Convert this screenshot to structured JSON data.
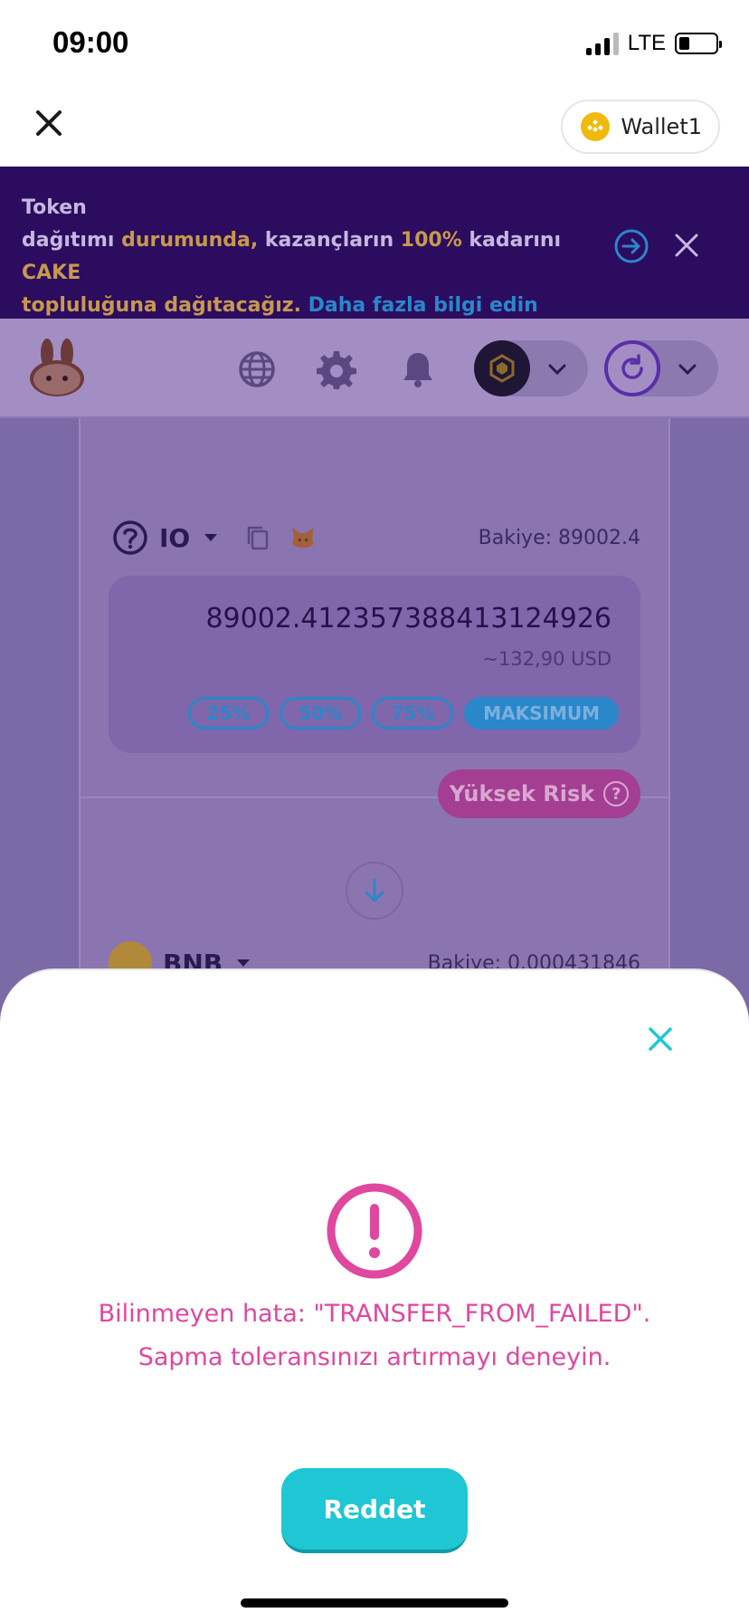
{
  "status_bar": {
    "time": "09:00",
    "network": "LTE"
  },
  "header": {
    "wallet_label": "Wallet1"
  },
  "banner": {
    "line1": "Token",
    "part_a": "dağıtımı ",
    "part_b": "durumunda,",
    "part_c": " kazançların ",
    "part_d": "100%",
    "part_e": " kadarını ",
    "part_f": "CAKE",
    "part_g": "topluluğuna dağıtacağız.",
    "link": "Daha fazla bilgi edin"
  },
  "swap": {
    "from_token": "IO",
    "from_balance": "Bakiye: 89002.4",
    "amount": "89002.412357388413124926",
    "amount_usd": "~132,90 USD",
    "percent_buttons": [
      "25%",
      "50%",
      "75%",
      "MAKSIMUM"
    ],
    "risk_label": "Yüksek Risk",
    "to_token": "BNB",
    "to_balance": "Bakiye: 0.000431846"
  },
  "modal": {
    "error_message": "Bilinmeyen hata: \"TRANSFER_FROM_FAILED\". Sapma toleransınızı artırmayı deneyin.",
    "dismiss_label": "Reddet"
  },
  "colors": {
    "primary": "#1fc7d4",
    "error": "#e0479e",
    "banner_bg": "#2b0c5e",
    "accent_gold": "#c7994e",
    "link_blue": "#2a87c9"
  },
  "icons": [
    "close-icon",
    "bnb-coin-icon",
    "arrow-right-circle-icon",
    "globe-icon",
    "gear-icon",
    "bell-icon",
    "chevron-down-icon",
    "refresh-icon",
    "help-icon",
    "copy-icon",
    "metamask-icon",
    "arrow-down-icon",
    "alert-icon"
  ]
}
